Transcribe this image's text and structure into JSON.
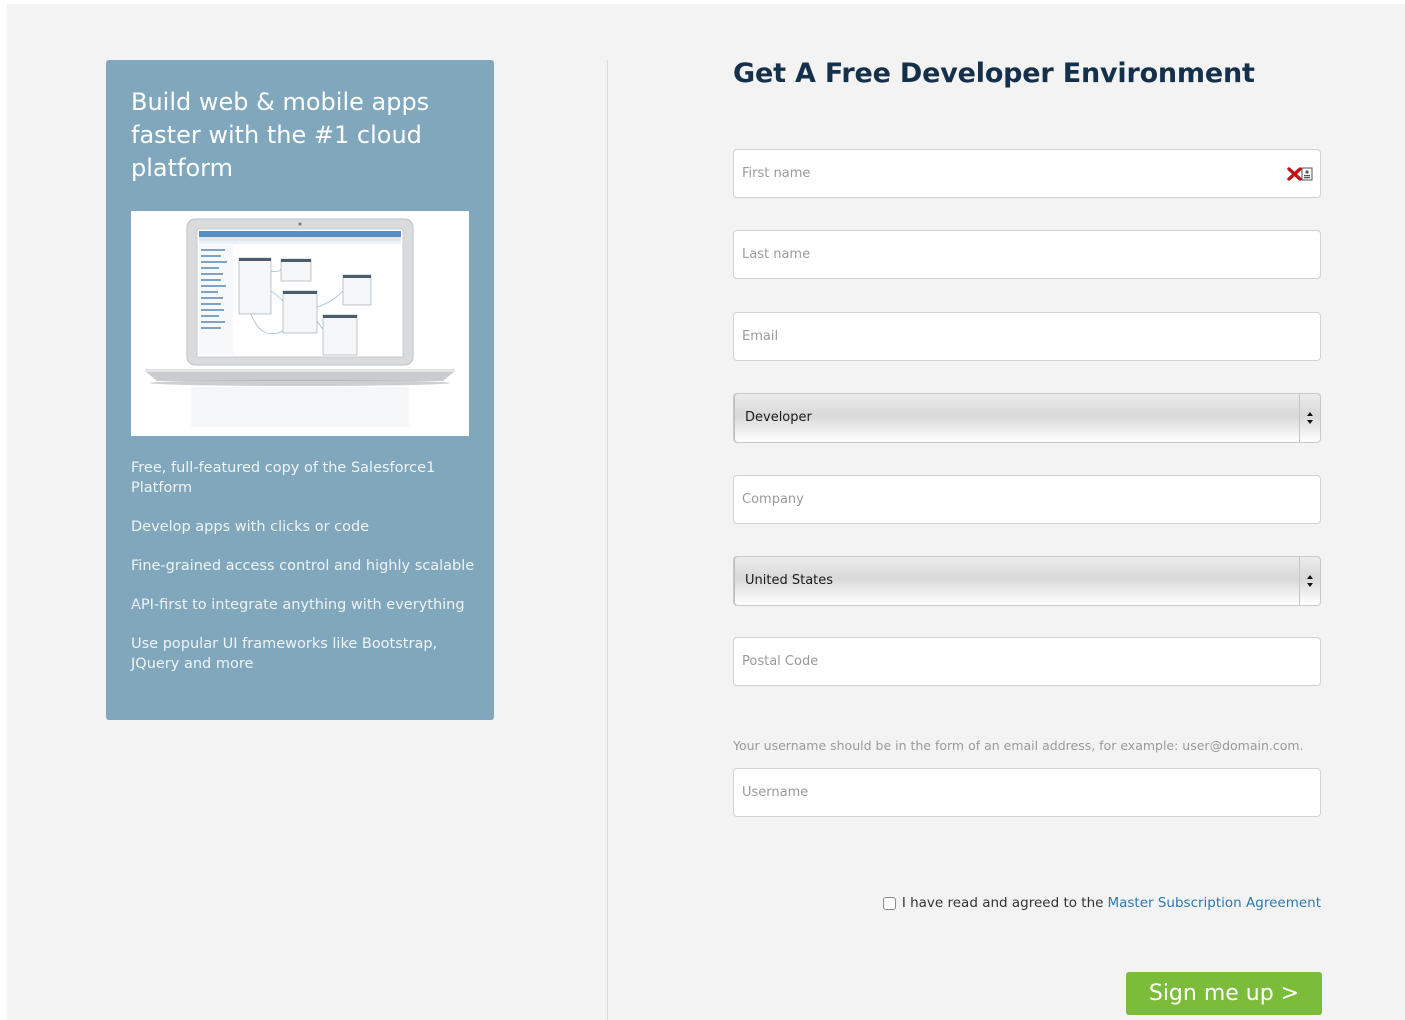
{
  "promo": {
    "title": "Build web & mobile apps faster with the #1 cloud platform",
    "image_alt": "laptop-screenshot",
    "features": [
      "Free, full-featured copy of the Salesforce1 Platform",
      "Develop apps with clicks or code",
      "Fine-grained access control and highly scalable",
      "API-first to integrate anything with everything",
      "Use popular UI frameworks like Bootstrap, JQuery and more"
    ],
    "background": "#80a7bb"
  },
  "form": {
    "title": "Get A Free Developer Environment",
    "first_name_placeholder": "First name",
    "last_name_placeholder": "Last name",
    "email_placeholder": "Email",
    "role_value": "Developer",
    "company_placeholder": "Company",
    "country_value": "United States",
    "postal_placeholder": "Postal Code",
    "username_hint": "Your username should be in the form of an email address, for example: user@domain.com.",
    "username_placeholder": "Username",
    "agree_text": "I have read and agreed to the",
    "agree_link": "Master Subscription Agreement",
    "submit_label": "Sign me up >",
    "submit_color": "#7bbd3b",
    "title_color": "#15304a",
    "link_color": "#2a7ab0"
  }
}
